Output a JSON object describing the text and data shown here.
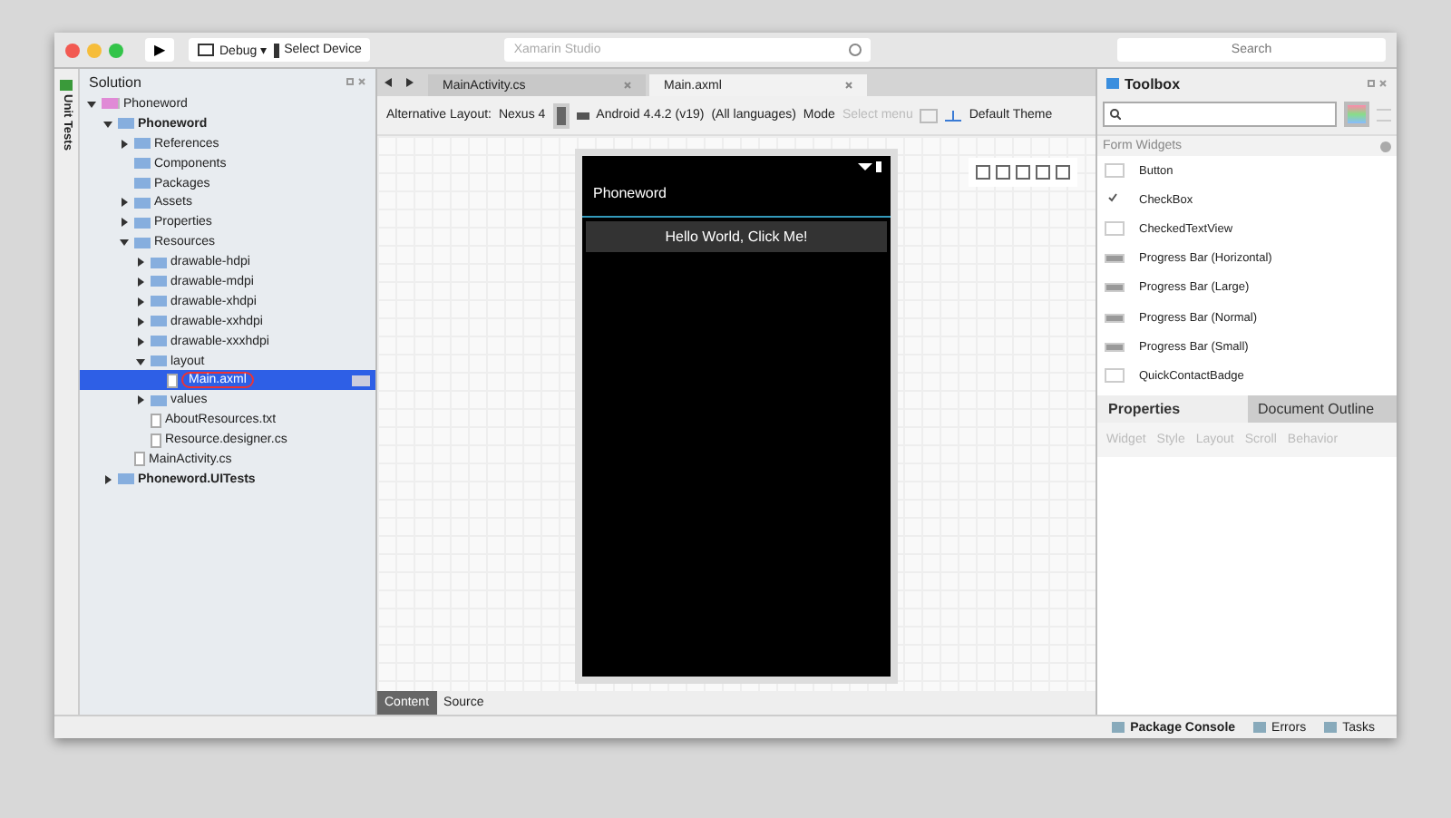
{
  "titlebar": {
    "run_symbol": "▶",
    "configuration": "Debug",
    "configuration_caret": "▾",
    "device": "Select Device",
    "title": "Xamarin Studio",
    "search": {
      "placeholder": "Search"
    }
  },
  "side_strip": {
    "label": "Unit Tests"
  },
  "solution": {
    "title": "Solution",
    "tree": [
      {
        "label": "Phoneword",
        "kind": "solution",
        "expanded": true,
        "selected": false,
        "children": [
          {
            "label": "Phoneword",
            "kind": "project",
            "expanded": true,
            "selected": false,
            "children": [
              {
                "label": "References",
                "kind": "folder",
                "expanded": false,
                "selected": false
              },
              {
                "label": "Components",
                "kind": "folder",
                "selected": false
              },
              {
                "label": "Packages",
                "kind": "folder",
                "selected": false
              },
              {
                "label": "Assets",
                "kind": "folder",
                "expanded": false,
                "selected": false
              },
              {
                "label": "Properties",
                "kind": "folder",
                "expanded": false,
                "selected": false
              },
              {
                "label": "Resources",
                "kind": "folder",
                "expanded": true,
                "selected": false,
                "children": [
                  {
                    "label": "drawable-hdpi",
                    "kind": "folder",
                    "expanded": false,
                    "selected": false
                  },
                  {
                    "label": "drawable-mdpi",
                    "kind": "folder",
                    "expanded": false,
                    "selected": false
                  },
                  {
                    "label": "drawable-xhdpi",
                    "kind": "folder",
                    "expanded": false,
                    "selected": false
                  },
                  {
                    "label": "drawable-xxhdpi",
                    "kind": "folder",
                    "expanded": false,
                    "selected": false
                  },
                  {
                    "label": "drawable-xxxhdpi",
                    "kind": "folder",
                    "expanded": false,
                    "selected": false
                  },
                  {
                    "label": "layout",
                    "kind": "folder",
                    "expanded": true,
                    "selected": false,
                    "children": [
                      {
                        "label": "Main.axml",
                        "kind": "file",
                        "selected": true
                      }
                    ]
                  },
                  {
                    "label": "values",
                    "kind": "folder",
                    "expanded": false,
                    "selected": false
                  },
                  {
                    "label": "AboutResources.txt",
                    "kind": "file",
                    "selected": false
                  },
                  {
                    "label": "Resource.designer.cs",
                    "kind": "file",
                    "selected": false
                  }
                ]
              },
              {
                "label": "MainActivity.cs",
                "kind": "file",
                "selected": false
              }
            ]
          },
          {
            "label": "Phoneword.UITests",
            "kind": "project",
            "expanded": false,
            "selected": false
          }
        ]
      }
    ]
  },
  "editor": {
    "tabs": [
      {
        "label": "MainActivity.cs",
        "selected": false
      },
      {
        "label": "Main.axml",
        "selected": true
      }
    ],
    "toolbar": {
      "layout_label": "Alternative Layout:",
      "device": "Nexus 4",
      "api": "Android 4.4.2 (v19)",
      "language": "(All languages)",
      "mode_label": "Mode",
      "mode_placeholder": "Select menu",
      "theme": "Default Theme"
    },
    "phone": {
      "app_title": "Phoneword",
      "button": "Hello World, Click Me!"
    },
    "bottom_tabs": [
      {
        "label": "Content",
        "selected": true
      },
      {
        "label": "Source",
        "selected": false
      }
    ]
  },
  "toolbox": {
    "title": "Toolbox",
    "category": "Form Widgets",
    "items": [
      {
        "label": "Button",
        "kind": "button"
      },
      {
        "label": "CheckBox",
        "kind": "check"
      },
      {
        "label": "CheckedTextView",
        "kind": "box"
      },
      {
        "label": "Progress Bar (Horizontal)",
        "kind": "bar"
      },
      {
        "label": "Progress Bar (Large)",
        "kind": "bar"
      },
      {
        "label": "Progress Bar (Normal)",
        "kind": "bar"
      },
      {
        "label": "Progress Bar (Small)",
        "kind": "bar"
      },
      {
        "label": "QuickContactBadge",
        "kind": "box"
      }
    ]
  },
  "properties": {
    "tabs": [
      {
        "label": "Properties",
        "selected": true
      },
      {
        "label": "Document Outline",
        "selected": false
      }
    ],
    "sections": [
      "Widget",
      "Style",
      "Layout",
      "Scroll",
      "Behavior"
    ]
  },
  "status_bar": [
    "Package Console",
    "Errors",
    "Tasks"
  ]
}
